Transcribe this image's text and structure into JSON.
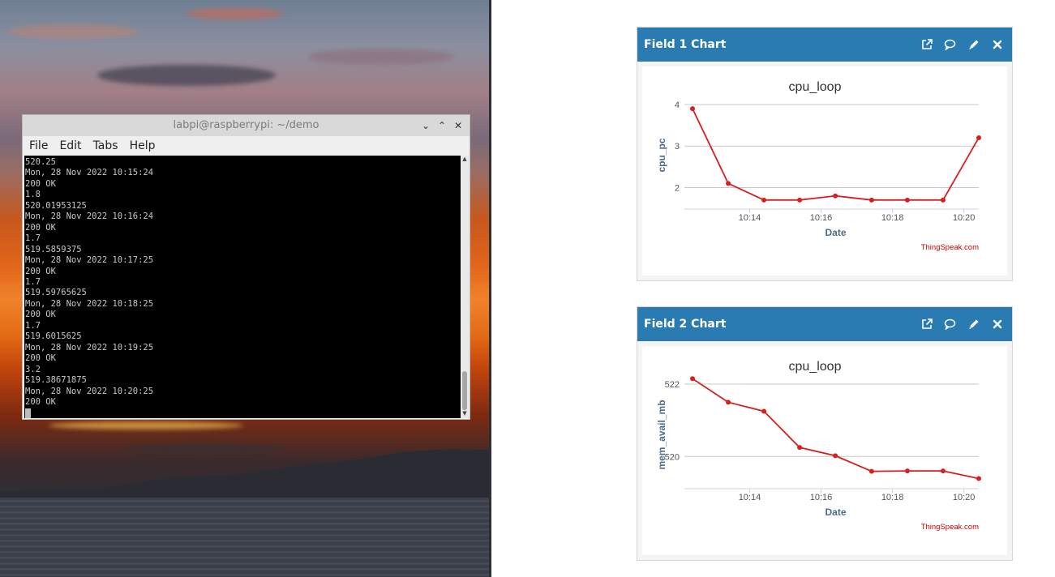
{
  "terminal": {
    "title": "labpi@raspberrypi: ~/demo",
    "controls": {
      "minimize": "⌄",
      "maximize": "⌃",
      "close": "✕"
    },
    "menu": [
      "File",
      "Edit",
      "Tabs",
      "Help"
    ],
    "lines": [
      "520.25",
      "Mon, 28 Nov 2022 10:15:24",
      "200 OK",
      "1.8",
      "520.01953125",
      "Mon, 28 Nov 2022 10:16:24",
      "200 OK",
      "1.7",
      "519.5859375",
      "Mon, 28 Nov 2022 10:17:25",
      "200 OK",
      "1.7",
      "519.59765625",
      "Mon, 28 Nov 2022 10:18:25",
      "200 OK",
      "1.7",
      "519.6015625",
      "Mon, 28 Nov 2022 10:19:25",
      "200 OK",
      "3.2",
      "519.38671875",
      "Mon, 28 Nov 2022 10:20:25",
      "200 OK"
    ]
  },
  "widgets": [
    {
      "title": "Field 1 Chart",
      "tool_icons": [
        "external-link-icon",
        "comment-icon",
        "pencil-icon",
        "close-icon"
      ],
      "credit": "ThingSpeak.com"
    },
    {
      "title": "Field 2 Chart",
      "tool_icons": [
        "external-link-icon",
        "comment-icon",
        "pencil-icon",
        "close-icon"
      ],
      "credit": "ThingSpeak.com"
    }
  ],
  "colors": {
    "header": "#2b7bb3",
    "line": "#d62020",
    "credit": "#cc0000",
    "axis_label": "#4a6b8c"
  },
  "chart_data": [
    {
      "type": "line",
      "title": "cpu_loop",
      "xlabel": "Date",
      "ylabel": "cpu_pc",
      "x": [
        "10:12:24",
        "10:13:24",
        "10:14:24",
        "10:15:24",
        "10:16:24",
        "10:17:25",
        "10:18:25",
        "10:19:25",
        "10:20:25"
      ],
      "xticks": [
        "10:14",
        "10:16",
        "10:18",
        "10:20"
      ],
      "xrange": [
        "10:12:24",
        "10:20:25"
      ],
      "yticks": [
        2,
        3,
        4
      ],
      "ylim": [
        1.56,
        4
      ],
      "series": [
        {
          "values": [
            3.9,
            2.1,
            1.7,
            1.7,
            1.8,
            1.7,
            1.7,
            1.7,
            3.2
          ]
        }
      ],
      "grid": true
    },
    {
      "type": "line",
      "title": "cpu_loop",
      "xlabel": "Date",
      "ylabel": "mem_avail_mb",
      "x": [
        "10:12:24",
        "10:13:24",
        "10:14:24",
        "10:15:24",
        "10:16:24",
        "10:17:25",
        "10:18:25",
        "10:19:25",
        "10:20:25"
      ],
      "xticks": [
        "10:14",
        "10:16",
        "10:18",
        "10:20"
      ],
      "xrange": [
        "10:12:24",
        "10:20:25"
      ],
      "yticks": [
        520,
        522
      ],
      "ylim": [
        519.2,
        522
      ],
      "series": [
        {
          "values": [
            522.15,
            521.5,
            521.25,
            520.25,
            520.02,
            519.59,
            519.6,
            519.6,
            519.39
          ]
        }
      ],
      "grid": true
    }
  ]
}
